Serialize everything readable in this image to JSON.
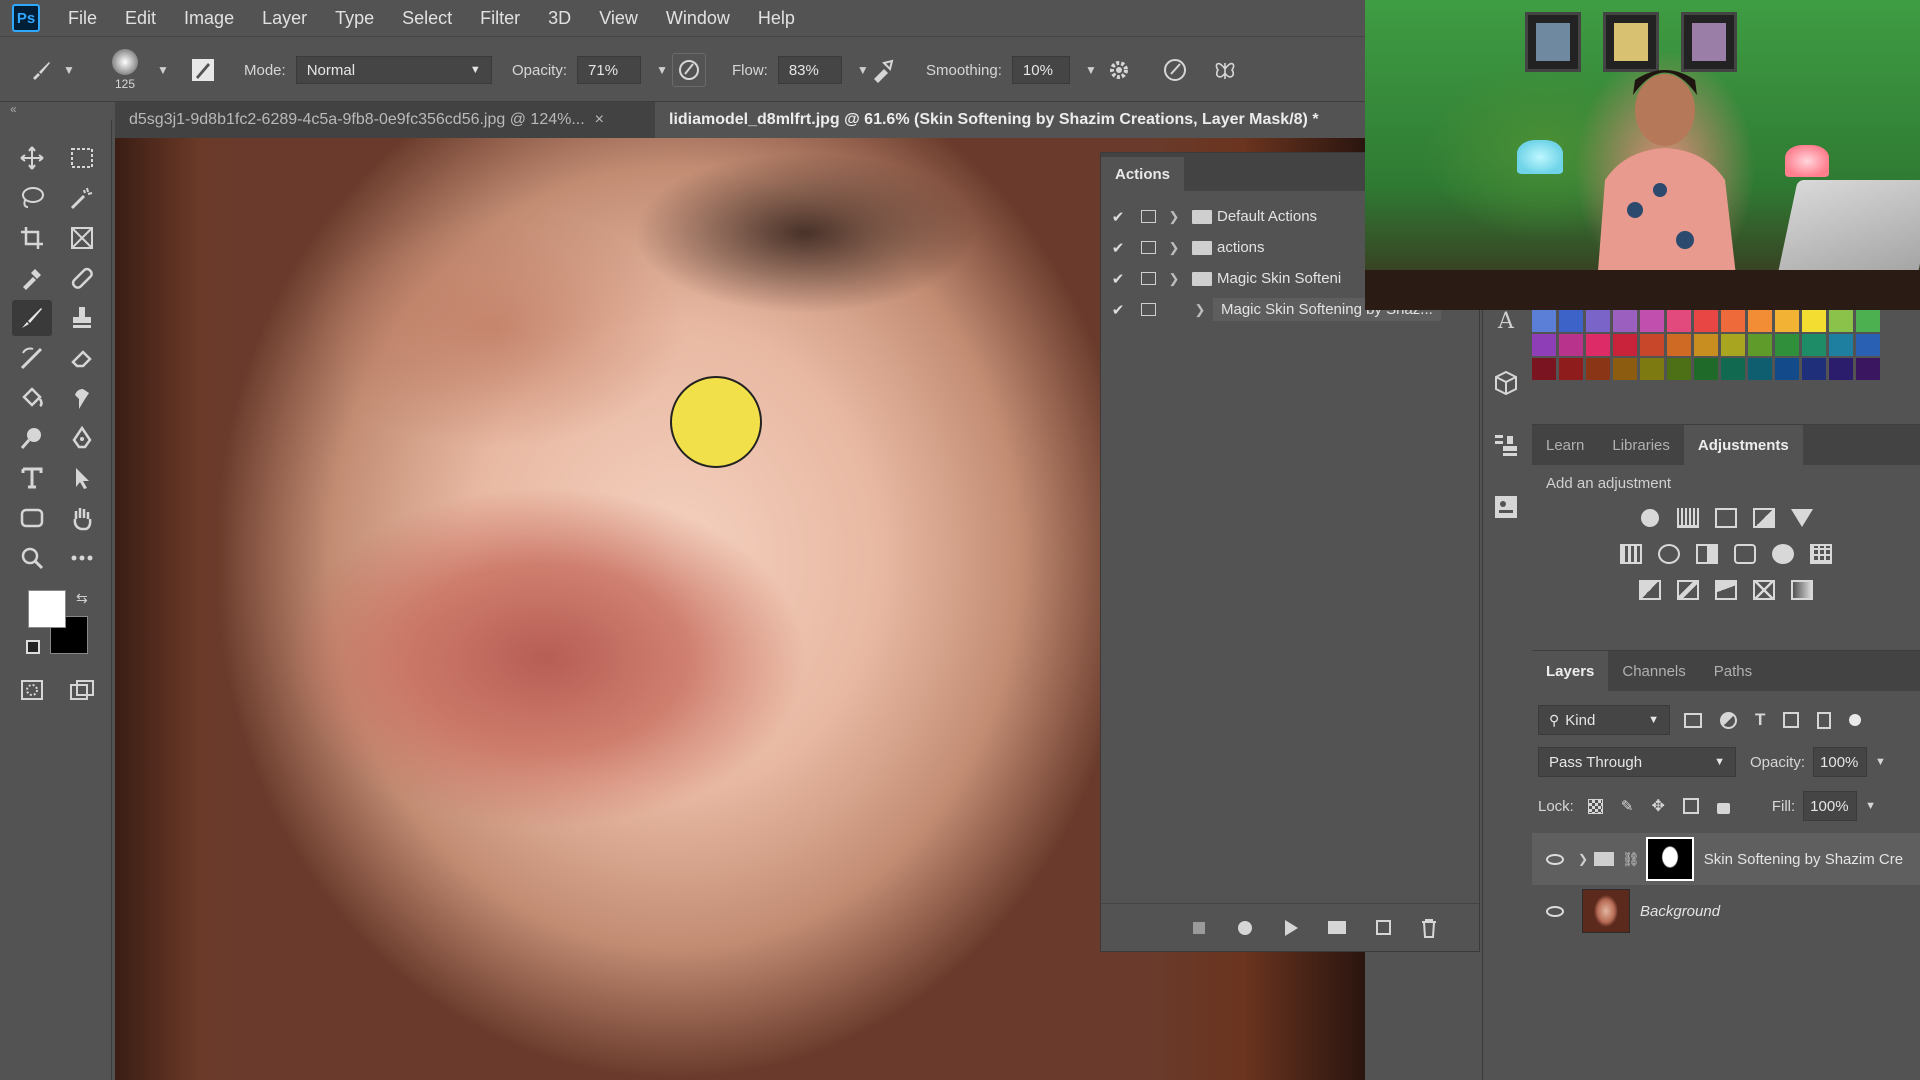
{
  "app": {
    "logo": "Ps"
  },
  "menu": [
    "File",
    "Edit",
    "Image",
    "Layer",
    "Type",
    "Select",
    "Filter",
    "3D",
    "View",
    "Window",
    "Help"
  ],
  "options": {
    "brush_size": "125",
    "mode_label": "Mode:",
    "mode_value": "Normal",
    "opacity_label": "Opacity:",
    "opacity_value": "71%",
    "flow_label": "Flow:",
    "flow_value": "83%",
    "smoothing_label": "Smoothing:",
    "smoothing_value": "10%"
  },
  "tabs": [
    {
      "label": "d5sg3j1-9d8b1fc2-6289-4c5a-9fb8-0e9fc356cd56.jpg @ 124%...",
      "close": "×"
    },
    {
      "label": "lidiamodel_d8mlfrt.jpg @ 61.6% (Skin Softening by Shazim Creations, Layer Mask/8) *"
    }
  ],
  "actions": {
    "title": "Actions",
    "items": [
      {
        "label": "Default Actions",
        "expanded": false
      },
      {
        "label": "actions",
        "expanded": false
      },
      {
        "label": "Magic Skin Softeni",
        "expanded": true
      },
      {
        "label": "Magic Skin Softening by Shaz...",
        "selected": true
      }
    ]
  },
  "adjustments": {
    "tabs": [
      "Learn",
      "Libraries",
      "Adjustments"
    ],
    "active_tab": "Adjustments",
    "add_label": "Add an adjustment"
  },
  "layers": {
    "tabs": [
      "Layers",
      "Channels",
      "Paths"
    ],
    "kind_label": "Kind",
    "blend_mode": "Pass Through",
    "opacity_label": "Opacity:",
    "opacity_value": "100%",
    "lock_label": "Lock:",
    "fill_label": "Fill:",
    "fill_value": "100%",
    "items": [
      {
        "name": "Skin Softening by Shazim Cre",
        "type": "group",
        "selected": true
      },
      {
        "name": "Background",
        "type": "image",
        "italic": true
      }
    ]
  },
  "colors": {
    "accent": "#31a8ff",
    "foreground": "#ffffff",
    "background": "#000000",
    "brush_cursor": "#f2e04a"
  },
  "swatches": [
    [
      "#5b7fd6",
      "#3e63c8",
      "#7a64c7",
      "#9b5fc0",
      "#c04fae",
      "#e24a7e",
      "#e84545",
      "#ef6a3a",
      "#f28c35",
      "#f2b233",
      "#f3dd31",
      "#8bc34a",
      "#4caf50"
    ],
    [
      "#8e3fb7",
      "#b8338c",
      "#dd2b68",
      "#c8233a",
      "#c8472b",
      "#cf6a25",
      "#c88e20",
      "#a8a621",
      "#5e9b2a",
      "#2f8f3a",
      "#1f8c68",
      "#1f7fa0",
      "#2a60b3"
    ],
    [
      "#7a1420",
      "#8f1c1c",
      "#8a3515",
      "#8c5c10",
      "#7d7a12",
      "#4d6f16",
      "#1f6a28",
      "#11694f",
      "#0f5e6f",
      "#134a8a",
      "#1f2f7a",
      "#2b1d6b",
      "#3a1660"
    ]
  ]
}
